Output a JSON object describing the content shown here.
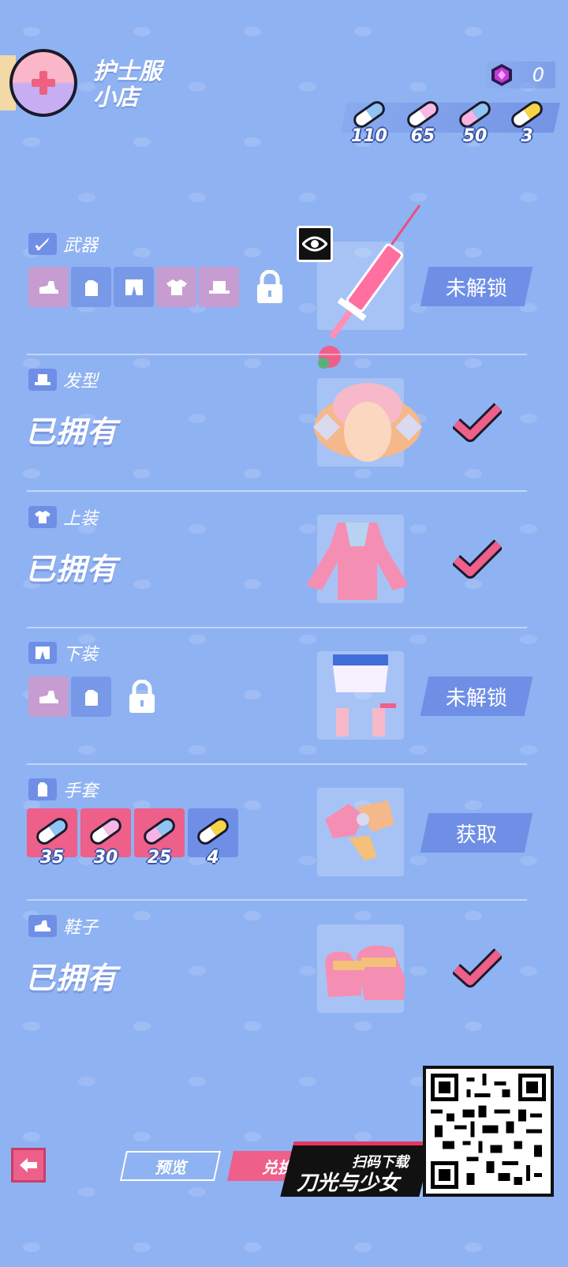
{
  "header": {
    "title_line1": "护士服",
    "title_line2": "小店",
    "gem_count": "0",
    "pills": [
      {
        "count": "110",
        "color_a": "#ffffff",
        "color_b": "#8ec5f5"
      },
      {
        "count": "65",
        "color_a": "#ffffff",
        "color_b": "#f7b8e6"
      },
      {
        "count": "50",
        "color_a": "#f6b3e4",
        "color_b": "#8ec5f5"
      },
      {
        "count": "3",
        "color_a": "#ffffff",
        "color_b": "#f7d34a"
      }
    ]
  },
  "items": {
    "weapon": {
      "label": "武器",
      "status": "未解锁",
      "icon": "sword-icon"
    },
    "hair": {
      "label": "发型",
      "status": "已拥有",
      "icon": "hat-icon"
    },
    "top": {
      "label": "上装",
      "status": "已拥有",
      "icon": "shirt-icon"
    },
    "bottom": {
      "label": "下装",
      "status": "未解锁",
      "icon": "shorts-icon"
    },
    "gloves": {
      "label": "手套",
      "action": "获取",
      "icon": "glove-icon",
      "costs": [
        "35",
        "30",
        "25",
        "4"
      ]
    },
    "shoes": {
      "label": "鞋子",
      "status": "已拥有",
      "icon": "shoe-icon"
    }
  },
  "bottom_bar": {
    "preview_label": "预览",
    "exchange_label": "兑换",
    "promo_sub": "扫码下载",
    "promo_title": "刀光与少女"
  },
  "colors": {
    "background": "#8fb2f2",
    "accent_pink": "#ee5f8a",
    "accent_blue": "#6f8fe6",
    "slot_pink": "#c79cd1"
  }
}
